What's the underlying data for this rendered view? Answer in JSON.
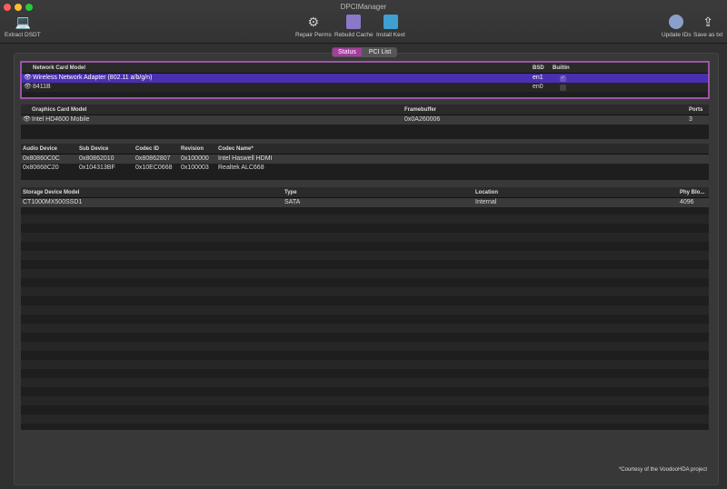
{
  "window": {
    "title": "DPCIManager"
  },
  "toolbar": {
    "extract": "Extract DSDT",
    "repair": "Repair Perms",
    "rebuild": "Rebuild Cache",
    "install": "Install Kext",
    "update": "Update IDs",
    "save": "Save as txt"
  },
  "tabs": {
    "status": "Status",
    "pci": "PCI List"
  },
  "network": {
    "headers": [
      "Network Card Model",
      "BSD",
      "Builtin"
    ],
    "rows": [
      {
        "model": "Wireless Network Adapter (802.11 a/b/g/n)",
        "bsd": "en1",
        "builtin": true
      },
      {
        "model": "8411B",
        "bsd": "en0",
        "builtin": false
      }
    ]
  },
  "graphics": {
    "headers": [
      "Graphics Card Model",
      "Framebuffer",
      "Ports"
    ],
    "rows": [
      {
        "model": "Intel HD4600 Mobile",
        "fb": "0x0A260006",
        "ports": "3"
      }
    ]
  },
  "audio": {
    "headers": [
      "Audio Device",
      "Sub Device",
      "Codec ID",
      "Revision",
      "Codec Name*"
    ],
    "rows": [
      [
        "0x80860C0C",
        "0x80862010",
        "0x80862807",
        "0x100000",
        "Intel Haswell HDMI"
      ],
      [
        "0x80868C20",
        "0x104313BF",
        "0x10EC0668",
        "0x100003",
        "Realtek ALC668"
      ]
    ]
  },
  "storage": {
    "headers": [
      "Storage Device Model",
      "Type",
      "Location",
      "Phy Blo..."
    ],
    "rows": [
      [
        "CT1000MX500SSD1",
        "SATA",
        "Internal",
        "4096"
      ]
    ]
  },
  "footnote": "*Courtesy of the VoodooHDA project"
}
